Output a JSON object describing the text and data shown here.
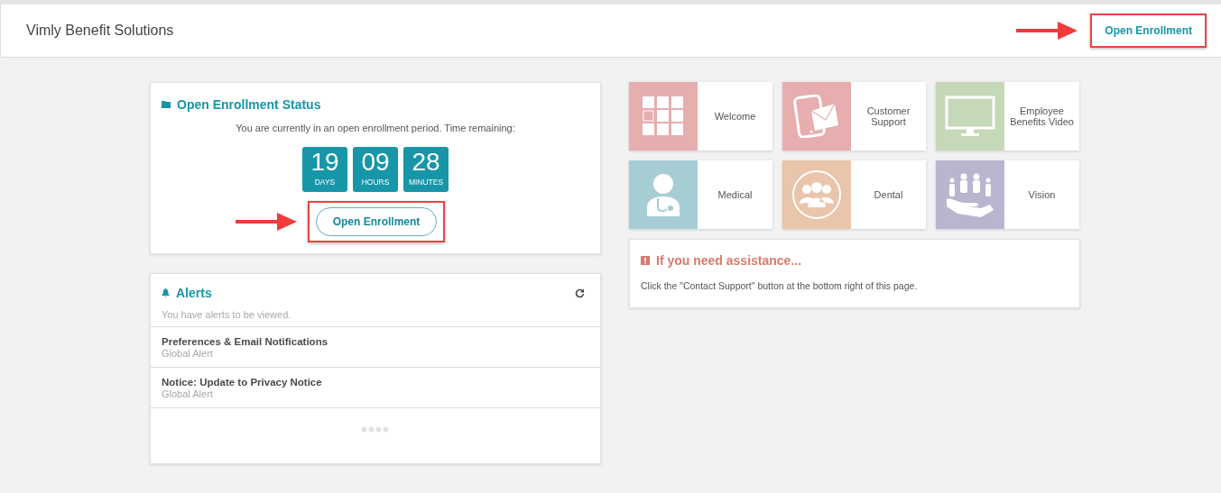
{
  "header": {
    "title": "Vimly Benefit Solutions",
    "action": {
      "label": "Open Enrollment",
      "annotated": true
    }
  },
  "status": {
    "title": "Open Enrollment Status",
    "message": "You are currently in an open enrollment period. Time remaining:",
    "countdown": [
      {
        "value": "19",
        "unit": "DAYS"
      },
      {
        "value": "09",
        "unit": "HOURS"
      },
      {
        "value": "28",
        "unit": "MINUTES"
      }
    ],
    "button": {
      "label": "Open Enrollment",
      "annotated": true
    }
  },
  "alerts": {
    "title": "Alerts",
    "message": "You have alerts to be viewed.",
    "items": [
      {
        "title": "Preferences & Email Notifications",
        "subtitle": "Global Alert"
      },
      {
        "title": "Notice: Update to Privacy Notice",
        "subtitle": "Global Alert"
      }
    ]
  },
  "tiles": [
    {
      "kind": "grid",
      "label": "Welcome",
      "color": "#e6aeae"
    },
    {
      "kind": "phone",
      "label": "Customer Support",
      "color": "#e6aeae"
    },
    {
      "kind": "monitor",
      "label": "Employee Benefits Video",
      "color": "#c5d8b8"
    },
    {
      "kind": "doctor",
      "label": "Medical",
      "color": "#a7cdd4"
    },
    {
      "kind": "group",
      "label": "Dental",
      "color": "#e9c5ab"
    },
    {
      "kind": "hand",
      "label": "Vision",
      "color": "#bab5cf"
    }
  ],
  "assistance": {
    "title": "If you need assistance...",
    "message": "Click the \"Contact Support\" button at the bottom right of this page."
  }
}
